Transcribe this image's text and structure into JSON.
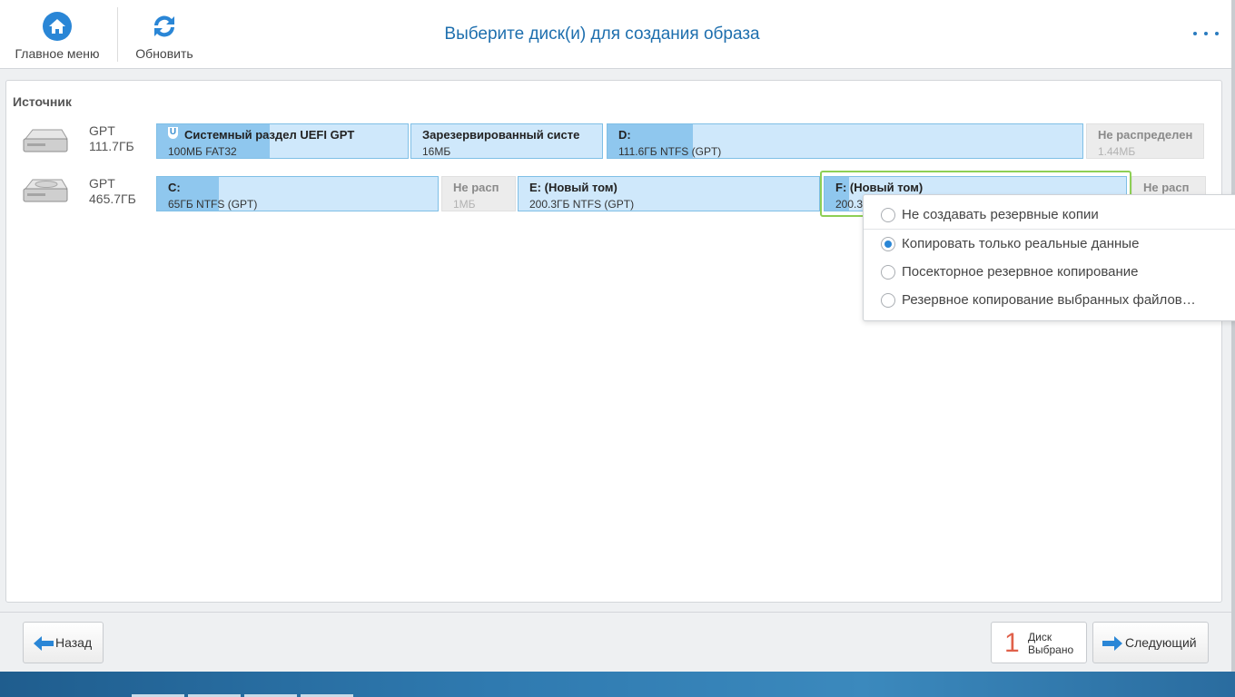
{
  "toolbar": {
    "main_menu_label": "Главное меню",
    "refresh_label": "Обновить",
    "title": "Выберите диск(и) для создания образа"
  },
  "source": {
    "label": "Источник",
    "disks": [
      {
        "type": "GPT",
        "size": "111.7ГБ",
        "partitions": [
          {
            "name": "Системный раздел UEFI GPT",
            "details": "100МБ FAT32",
            "badge": "U",
            "used_fraction": 0.45
          },
          {
            "name": "Зарезервированный систе",
            "details": "16МБ",
            "used_fraction": 0.0
          },
          {
            "name": "D:",
            "details": "111.6ГБ NTFS (GPT)",
            "used_fraction": 0.18
          },
          {
            "name": "Не распределен",
            "details": "1.44МБ",
            "unallocated": true
          }
        ]
      },
      {
        "type": "GPT",
        "size": "465.7ГБ",
        "partitions": [
          {
            "name": "C:",
            "details": "65ГБ NTFS (GPT)",
            "used_fraction": 0.22
          },
          {
            "name": "Не расп",
            "details": "1МБ",
            "unallocated": true
          },
          {
            "name": "E: (Новый том)",
            "details": "200.3ГБ NTFS (GPT)",
            "used_fraction": 0.0
          },
          {
            "name": "F: (Новый том)",
            "details": "200.3",
            "used_fraction": 0.08,
            "selected": true
          },
          {
            "name": "Не расп",
            "details": "",
            "unallocated": true
          }
        ]
      }
    ]
  },
  "backup_menu": {
    "options": [
      {
        "label": "Не создавать резервные копии",
        "checked": false
      },
      {
        "label": "Копировать только реальные данные",
        "checked": true
      },
      {
        "label": "Посекторное резервное копирование",
        "checked": false
      },
      {
        "label": "Резервное копирование выбранных файлов…",
        "checked": false
      }
    ]
  },
  "footer": {
    "back_label": "Назад",
    "selected_count": "1",
    "selected_line1": "Диск",
    "selected_line2": "Выбрано",
    "next_label": "Следующий"
  },
  "colors": {
    "accent": "#2a86d6",
    "title": "#1e6fae",
    "partition_fill": "#cfe8fb",
    "partition_used": "#8fc7ee",
    "selection": "#8ecf55",
    "counter": "#e0604a"
  },
  "icons": {
    "main_menu": "home-icon",
    "refresh": "refresh-icon",
    "more": "more-dots-icon",
    "disk": "hard-disk-icon",
    "back": "arrow-left-icon",
    "next": "arrow-right-icon"
  }
}
